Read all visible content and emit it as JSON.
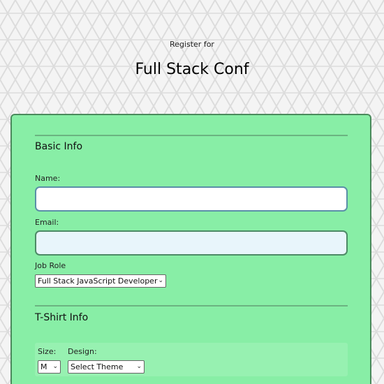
{
  "header": {
    "register_for": "Register for",
    "title": "Full Stack Conf"
  },
  "basic_info": {
    "title": "Basic Info",
    "name_label": "Name:",
    "name_value": "",
    "email_label": "Email:",
    "email_value": "",
    "job_role_label": "Job Role",
    "job_role_selected": "Full Stack JavaScript Developer"
  },
  "tshirt_info": {
    "title": "T-Shirt Info",
    "size_label": "Size:",
    "size_selected": "M",
    "design_label": "Design:",
    "design_selected": "Select Theme"
  },
  "colors": {
    "card_bg": "#88eea6",
    "card_border": "#4a8a5c"
  }
}
